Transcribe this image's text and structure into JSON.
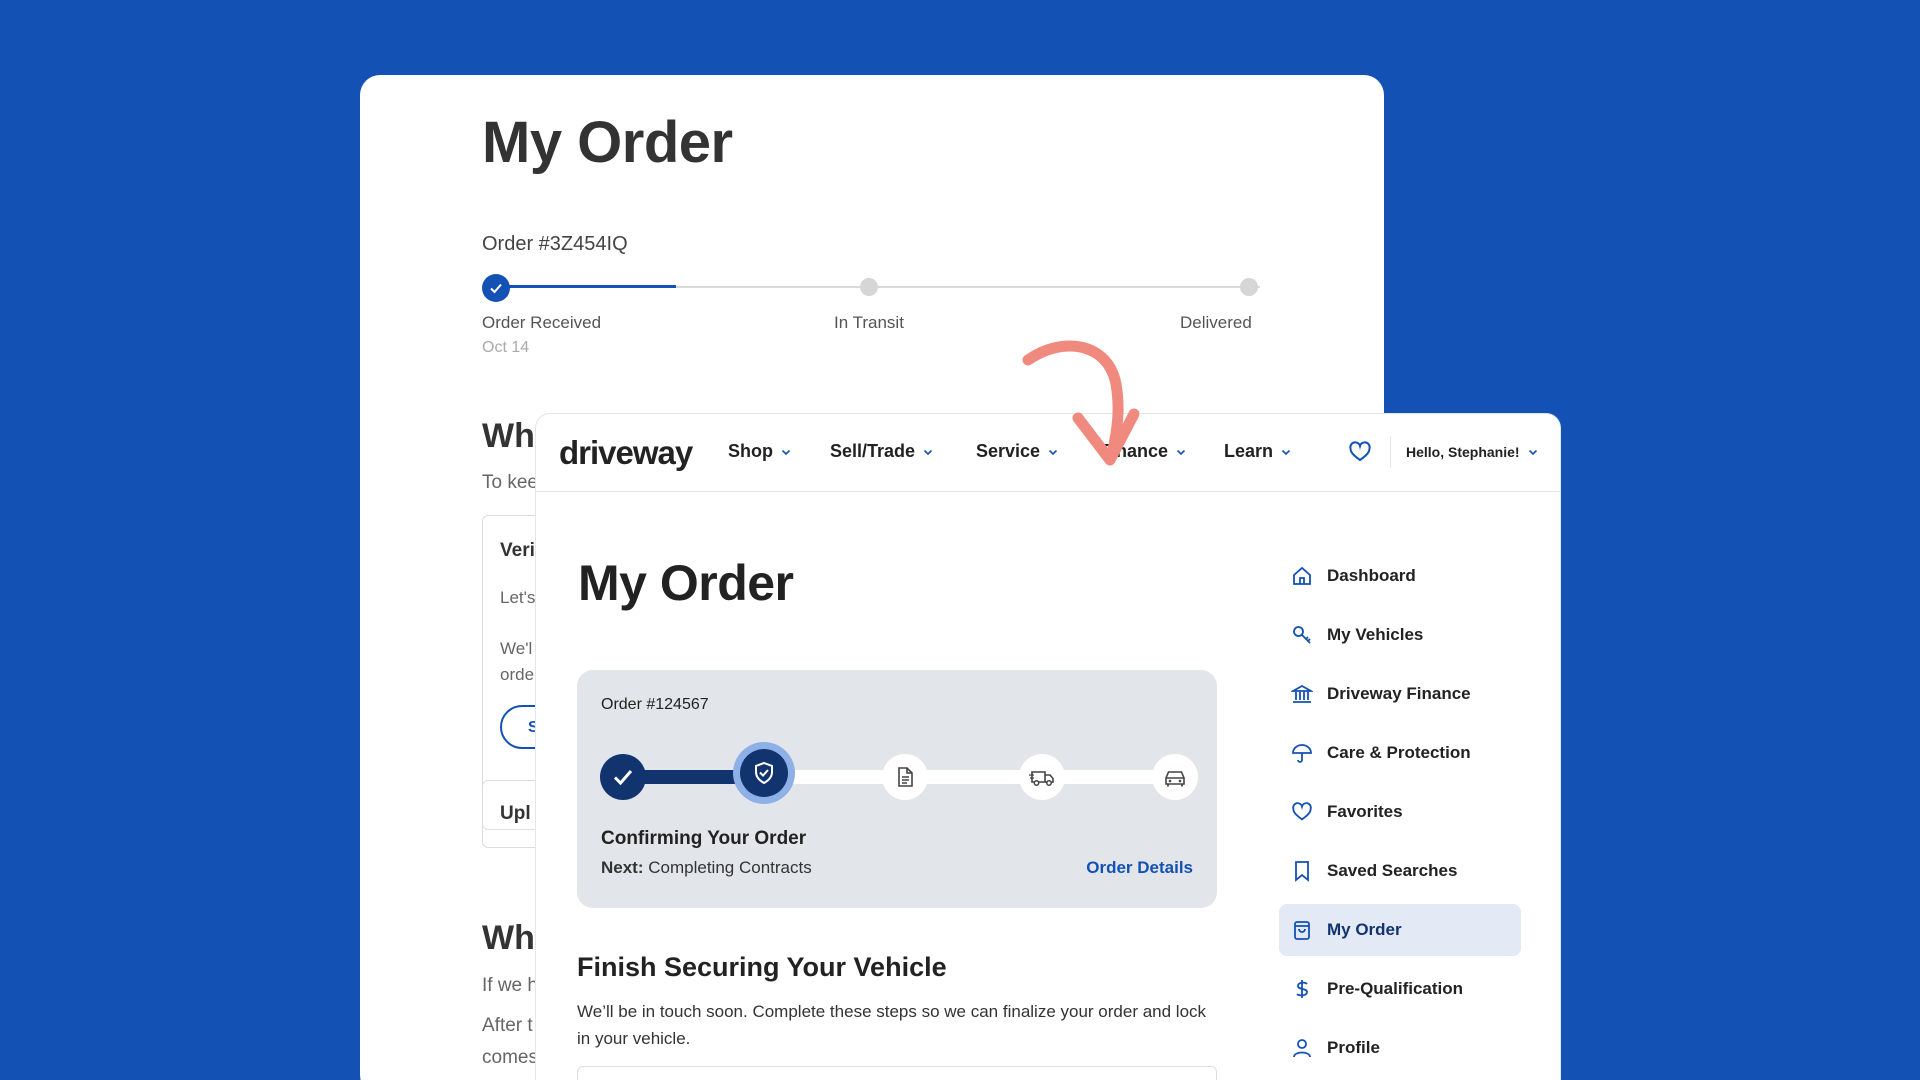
{
  "back": {
    "title": "My Order",
    "order_number": "Order #3Z454IQ",
    "steps": [
      {
        "label": "Order Received",
        "date": "Oct 14"
      },
      {
        "label": "In Transit"
      },
      {
        "label": "Delivered"
      }
    ],
    "heading_1": "Wh",
    "text_1": "To kee",
    "box_heading": "Veri",
    "box_text_1": "Let's",
    "box_text_2a": "We'l",
    "box_text_2b": "orde",
    "box_button": "S",
    "box2_heading": "Upl",
    "heading_2": "Wh",
    "text_2": "If we h",
    "text_3": "After t",
    "text_4": "comes"
  },
  "nav": {
    "logo": "driveway",
    "items": [
      "Shop",
      "Sell/Trade",
      "Service",
      "Finance",
      "Learn"
    ],
    "user": "Hello, Stephanie!"
  },
  "main": {
    "title": "My Order",
    "order": {
      "number": "Order #124567",
      "status": "Confirming Your Order",
      "next_label": "Next:",
      "next_value": "Completing Contracts",
      "details_link": "Order Details",
      "steps": [
        "check-icon",
        "shield-check-icon",
        "document-icon",
        "delivery-truck-icon",
        "car-icon"
      ]
    },
    "finish": {
      "heading": "Finish Securing Your Vehicle",
      "text": "We’ll be in touch soon. Complete these steps so we can finalize your order and lock in your vehicle."
    }
  },
  "sidebar": {
    "items": [
      {
        "label": "Dashboard",
        "icon": "home-icon"
      },
      {
        "label": "My Vehicles",
        "icon": "car-key-icon"
      },
      {
        "label": "Driveway Finance",
        "icon": "bank-icon"
      },
      {
        "label": "Care & Protection",
        "icon": "umbrella-icon"
      },
      {
        "label": "Favorites",
        "icon": "heart-icon"
      },
      {
        "label": "Saved Searches",
        "icon": "bookmark-icon"
      },
      {
        "label": "My Order",
        "icon": "bag-icon",
        "active": true
      },
      {
        "label": "Pre-Qualification",
        "icon": "dollar-icon"
      },
      {
        "label": "Profile",
        "icon": "person-icon"
      }
    ]
  },
  "colors": {
    "background": "#1351b4",
    "brand_dark": "#12346e",
    "link": "#1351b4",
    "arrow": "#f08a7e"
  }
}
